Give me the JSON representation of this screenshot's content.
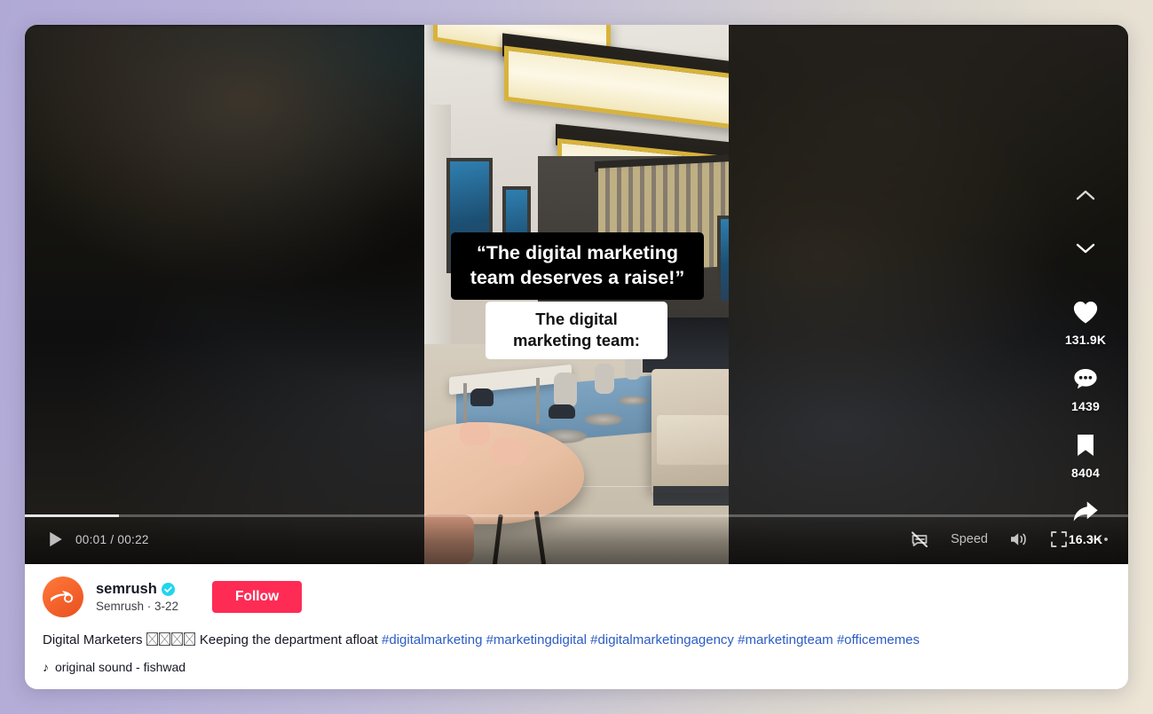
{
  "video": {
    "captions": [
      {
        "id": "quote",
        "text": "“The digital marketing team deserves a raise!”",
        "style": "dark"
      },
      {
        "id": "reaction",
        "text": "The digital marketing team:",
        "style": "light"
      }
    ],
    "controls": {
      "play_label": "play-icon",
      "time_current": "00:01",
      "time_separator": "/",
      "time_total": "00:22",
      "time_display": "00:01 / 00:22",
      "speed_label": "Speed",
      "subtitles_icon": "subtitles-off-icon",
      "volume_icon": "volume-on-icon",
      "fullscreen_icon": "fullscreen-icon",
      "more_icon": "more-options-icon",
      "progress_percent": 8.5
    },
    "rail": {
      "prev_icon": "chevron-up-icon",
      "next_icon": "chevron-down-icon",
      "actions": [
        {
          "icon": "heart-icon",
          "name": "like",
          "count": "131.9K"
        },
        {
          "icon": "comment-icon",
          "name": "comment",
          "count": "1439"
        },
        {
          "icon": "bookmark-icon",
          "name": "bookmark",
          "count": "8404"
        },
        {
          "icon": "share-icon",
          "name": "share",
          "count": "16.3K"
        }
      ]
    }
  },
  "post": {
    "author": {
      "username": "semrush",
      "display_line": "Semrush · 3-22",
      "verified": true,
      "avatar_alt": "semrush-logo"
    },
    "follow_label": "Follow",
    "caption": {
      "lead": "Digital Marketers ",
      "emoji_count": 4,
      "body": " Keeping the department afloat ",
      "hashtags": [
        "#digitalmarketing",
        "#marketingdigital",
        "#digitalmarketingagency",
        "#marketingteam",
        "#officememes"
      ]
    },
    "sound": {
      "icon": "music-note-icon",
      "label": "original sound - fishwad"
    }
  },
  "theme": {
    "accent_follow": "#fe2c55",
    "link_blue": "#2b5cc4",
    "verified_cyan": "#20d5ec",
    "brand_orange": "#f4622c",
    "card_bg": "#ffffff",
    "page_gradient_from": "#b0a9d6",
    "page_gradient_to": "#ece5d5"
  }
}
